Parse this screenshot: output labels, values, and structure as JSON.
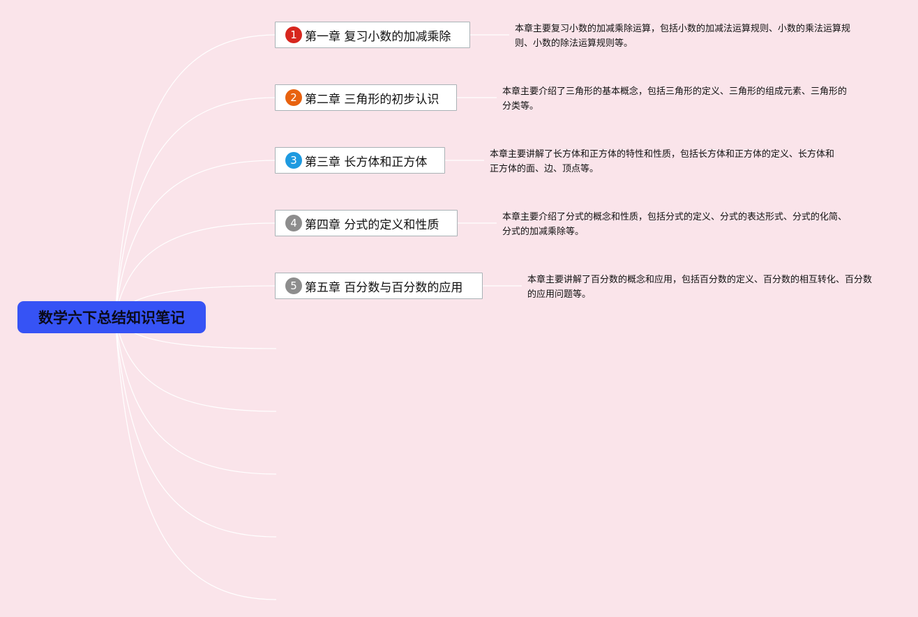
{
  "root": {
    "title": "数学六下总结知识笔记"
  },
  "chapters": [
    {
      "number": "1",
      "badge_color": "#d7261e",
      "title": "第一章 复习小数的加减乘除",
      "description": "本章主要复习小数的加减乘除运算，包括小数的加减法运算规则、小数的乘法运算规则、小数的除法运算规则等。"
    },
    {
      "number": "2",
      "badge_color": "#e8620f",
      "title": "第二章 三角形的初步认识",
      "description": "本章主要介绍了三角形的基本概念，包括三角形的定义、三角形的组成元素、三角形的分类等。"
    },
    {
      "number": "3",
      "badge_color": "#1e9ae0",
      "title": "第三章 长方体和正方体",
      "description": "本章主要讲解了长方体和正方体的特性和性质，包括长方体和正方体的定义、长方体和正方体的面、边、顶点等。"
    },
    {
      "number": "4",
      "badge_color": "#8d8d8d",
      "title": "第四章 分式的定义和性质",
      "description": "本章主要介绍了分式的概念和性质，包括分式的定义、分式的表达形式、分式的化简、分式的加减乘除等。"
    },
    {
      "number": "5",
      "badge_color": "#8d8d8d",
      "title": "第五章 百分数与百分数的应用",
      "description": "本章主要讲解了百分数的概念和应用，包括百分数的定义、百分数的相互转化、百分数的应用问题等。"
    }
  ],
  "colors": {
    "background": "#fae4ea",
    "root_fill": "#3653f5",
    "connector": "#ffffff"
  }
}
